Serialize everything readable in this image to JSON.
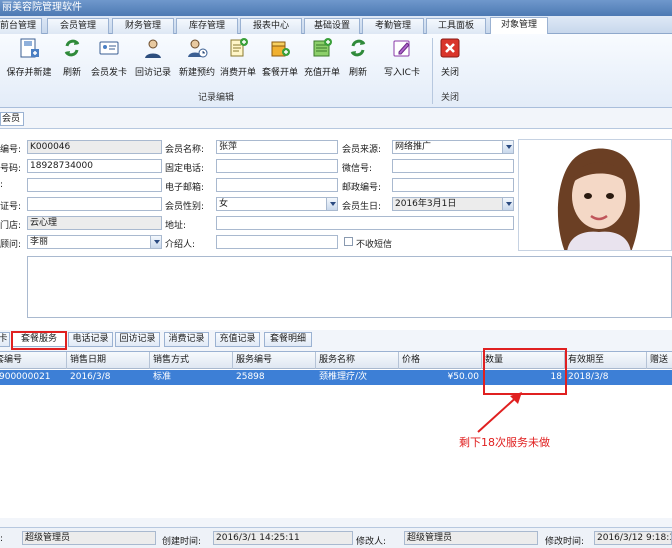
{
  "window": {
    "title": "丽美容院管理软件"
  },
  "menu_tabs": [
    "前台管理",
    "会员管理",
    "财务管理",
    "库存管理",
    "报表中心",
    "基础设置",
    "考勤管理",
    "工具面板",
    "对象管理"
  ],
  "ribbon": {
    "buttons": [
      {
        "label": "保存并新建",
        "icon": "save-new-icon"
      },
      {
        "label": "刷新",
        "icon": "refresh-icon"
      },
      {
        "label": "会员发卡",
        "icon": "member-card-icon"
      },
      {
        "label": "回访记录",
        "icon": "callback-record-icon"
      },
      {
        "label": "新建预约",
        "icon": "new-appointment-icon"
      },
      {
        "label": "消费开单",
        "icon": "consume-order-icon"
      },
      {
        "label": "套餐开单",
        "icon": "package-order-icon"
      },
      {
        "label": "充值开单",
        "icon": "recharge-order-icon"
      },
      {
        "label": "刷新",
        "icon": "refresh-icon"
      },
      {
        "label": "写入IC卡",
        "icon": "write-card-icon"
      },
      {
        "label": "关闭",
        "icon": "close-icon"
      }
    ],
    "group_edit_label": "记录编辑",
    "group_close_label": "关闭"
  },
  "subtab_label": "会员",
  "form": {
    "card_no_label": "编号:",
    "card_no": "K000046",
    "name_label": "会员名称:",
    "name": "张萍",
    "source_label": "会员来源:",
    "source": "网络推广",
    "phone_label": "号码:",
    "phone": "18928734000",
    "landline_label": "固定电话:",
    "landline": "",
    "wechat_label": "微信号:",
    "wechat": "",
    "row3_label": ":",
    "row3": "",
    "email_label": "电子邮箱:",
    "email": "",
    "zip_label": "邮政编号:",
    "zip": "",
    "id_label": "证号:",
    "id_no": "",
    "gender_label": "会员性别:",
    "gender": "女",
    "birthday_label": "会员生日:",
    "birthday": "2016年3月1日",
    "store_label": "门店:",
    "store": "云心理",
    "address_label": "地址:",
    "address": "",
    "advisor_label": "顾问:",
    "advisor": "李丽",
    "referrer_label": "介绍人:",
    "referrer": "",
    "no_sms_label": "不收短信"
  },
  "grid_tabs": [
    "卡",
    "套餐服务",
    "电话记录",
    "回访记录",
    "消费记录",
    "充值记录",
    "套餐明细"
  ],
  "grid": {
    "columns": [
      "套编号",
      "销售日期",
      "销售方式",
      "服务编号",
      "服务名称",
      "价格",
      "数量",
      "有效期至",
      "赠送"
    ],
    "rows": [
      [
        "900000021",
        "2016/3/8",
        "标准",
        "25898",
        "颈椎理疗/次",
        "¥50.00",
        "18",
        "2018/3/8",
        ""
      ]
    ]
  },
  "annotation": {
    "text": "剩下18次服务未做"
  },
  "footer": {
    "creator_label": ":",
    "creator": "超级管理员",
    "created_label": "创建时间:",
    "created": "2016/3/1 14:25:11",
    "modifier_label": "修改人:",
    "modifier": "超级管理员",
    "modified_label": "修改时间:",
    "modified": "2016/3/12 9:18:3"
  },
  "colors": {
    "selected_row": "#3d7fd6",
    "annotation": "#e02020",
    "title_bar": "#5b86bf"
  }
}
